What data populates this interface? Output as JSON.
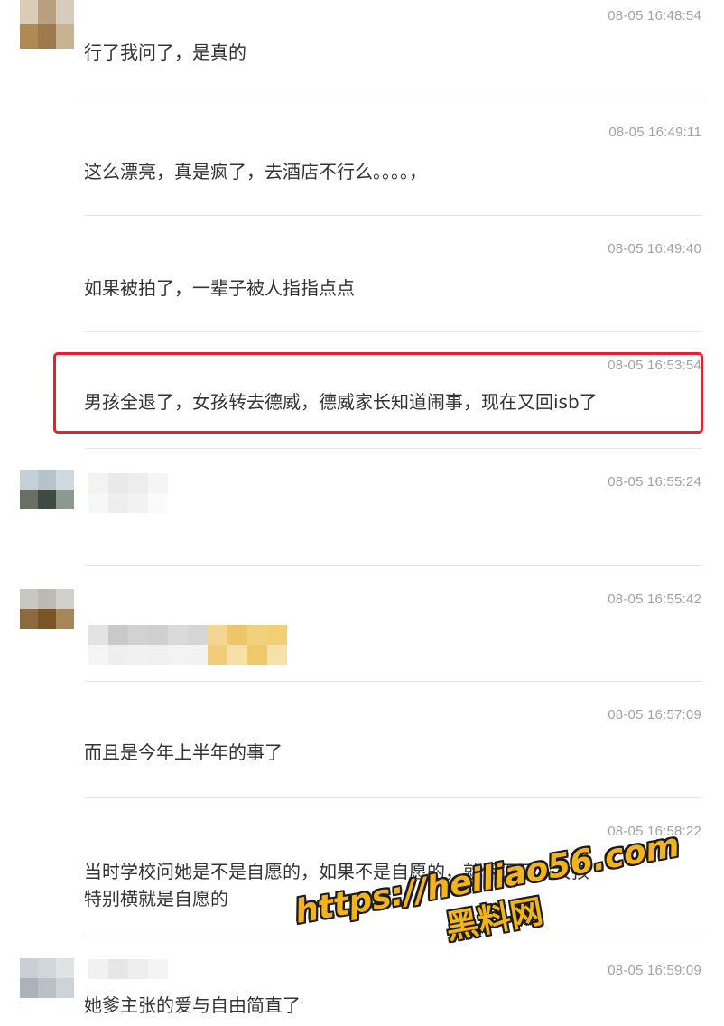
{
  "comments": [
    {
      "time": "08-05 16:48:54",
      "text": "行了我问了，是真的"
    },
    {
      "time": "08-05 16:49:11",
      "text": "这么漂亮，真是疯了，去酒店不行么。。。。，"
    },
    {
      "time": "08-05 16:49:40",
      "text": "如果被拍了，一辈子被人指指点点"
    },
    {
      "time": "08-05 16:53:54",
      "text": "男孩全退了，女孩转去德威，德威家长知道闹事，现在又回isb了"
    },
    {
      "time": "08-05 16:55:24",
      "text": ""
    },
    {
      "time": "08-05 16:55:42",
      "text": ""
    },
    {
      "time": "08-05 16:57:09",
      "text": "而且是今年上半年的事了"
    },
    {
      "time": "08-05 16:58:22",
      "text": "当时学校问她是不是自愿的，如果不是自愿的，就保下了，女孩\n特别横就是自愿的"
    },
    {
      "time": "08-05 16:59:09",
      "text": "她爹主张的爱与自由简直了"
    }
  ],
  "watermark": {
    "url": "https://heiliao56.com",
    "name": "黑料网"
  },
  "colors": {
    "highlight": "#e8202a",
    "timestamp": "#a3a3a3",
    "text": "#333333",
    "watermark": "#f4b318"
  }
}
